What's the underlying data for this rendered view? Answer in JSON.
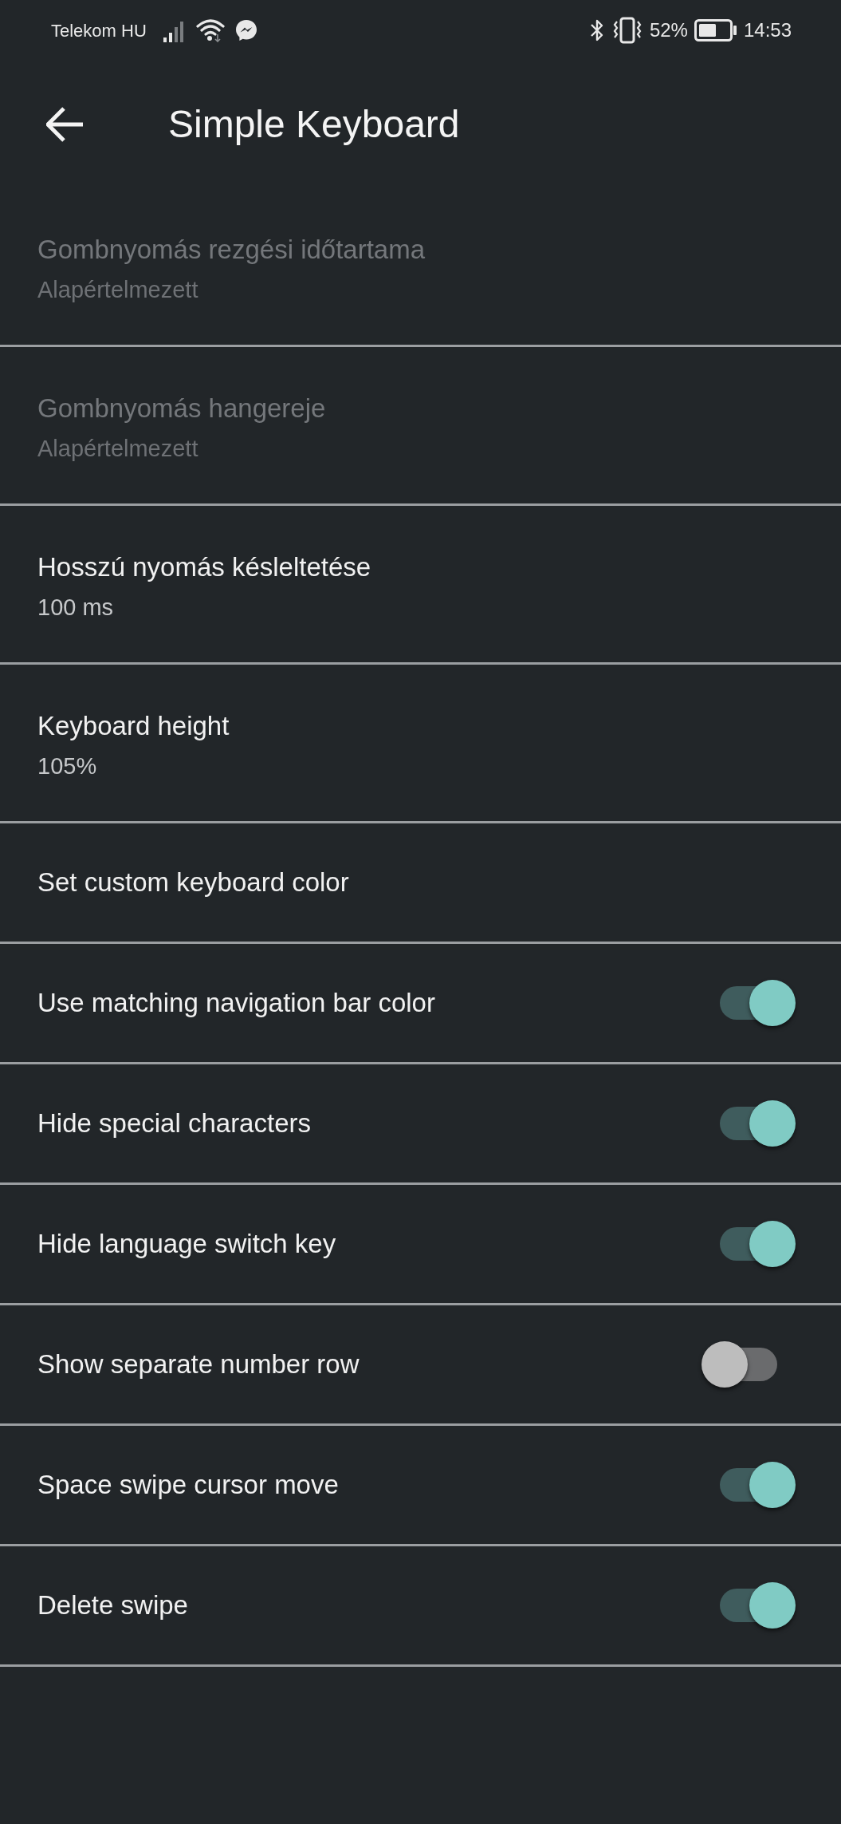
{
  "status_bar": {
    "carrier": "Telekom HU",
    "battery_percent": "52%",
    "time": "14:53"
  },
  "app_bar": {
    "title": "Simple Keyboard"
  },
  "settings": [
    {
      "kind": "value",
      "title": "Gombnyomás rezgési időtartama",
      "value": "Alapértelmezett",
      "disabled": true
    },
    {
      "kind": "value",
      "title": "Gombnyomás hangereje",
      "value": "Alapértelmezett",
      "disabled": true
    },
    {
      "kind": "value",
      "title": "Hosszú nyomás késleltetése",
      "value": "100 ms",
      "disabled": false
    },
    {
      "kind": "value",
      "title": "Keyboard height",
      "value": "105%",
      "disabled": false
    },
    {
      "kind": "action",
      "title": "Set custom keyboard color",
      "disabled": false
    },
    {
      "kind": "toggle",
      "title": "Use matching navigation bar color",
      "on": true,
      "disabled": false
    },
    {
      "kind": "toggle",
      "title": "Hide special characters",
      "on": true,
      "disabled": false
    },
    {
      "kind": "toggle",
      "title": "Hide language switch key",
      "on": true,
      "disabled": false
    },
    {
      "kind": "toggle",
      "title": "Show separate number row",
      "on": false,
      "disabled": false
    },
    {
      "kind": "toggle",
      "title": "Space swipe cursor move",
      "on": true,
      "disabled": false
    },
    {
      "kind": "toggle",
      "title": "Delete swipe",
      "on": true,
      "disabled": false
    }
  ]
}
